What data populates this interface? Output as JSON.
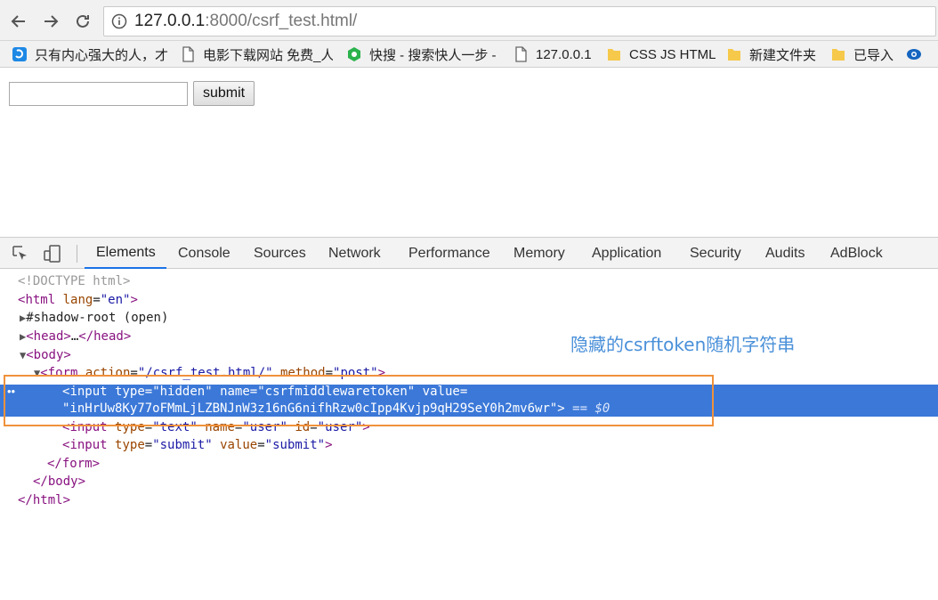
{
  "browser": {
    "url_host": "127.0.0.1",
    "url_rest": ":8000/csrf_test.html/"
  },
  "bookmarks": [
    {
      "label": "只有内心强大的人，才",
      "icon": "blue-site-icon"
    },
    {
      "label": "电影下载网站 免费_人",
      "icon": "page-icon"
    },
    {
      "label": "快搜 - 搜索快人一步 -",
      "icon": "kuaisou-icon"
    },
    {
      "label": "127.0.0.1",
      "icon": "page-icon"
    },
    {
      "label": "CSS JS HTML",
      "icon": "folder-icon"
    },
    {
      "label": "新建文件夹",
      "icon": "folder-icon"
    },
    {
      "label": "已导入",
      "icon": "folder-icon"
    }
  ],
  "page": {
    "submit_label": "submit"
  },
  "devtools": {
    "tabs": [
      "Elements",
      "Console",
      "Sources",
      "Network",
      "Performance",
      "Memory",
      "Application",
      "Security",
      "Audits",
      "AdBlock"
    ],
    "active_tab": "Elements",
    "dom": {
      "doctype": "<!DOCTYPE html>",
      "html_open": "html",
      "lang_attr": "lang",
      "lang_val": "\"en\"",
      "shadow": "#shadow-root (open)",
      "head": "head",
      "body": "body",
      "form": "form",
      "form_action_attr": "action",
      "form_action_val": "\"/csrf_test.html/\"",
      "form_method_attr": "method",
      "form_method_val": "\"post\"",
      "input": "input",
      "type_attr": "type",
      "name_attr": "name",
      "value_attr": "value",
      "id_attr": "id",
      "hidden_val": "\"hidden\"",
      "hidden_name_val": "\"csrfmiddlewaretoken\"",
      "token_val": "\"inHrUw8Ky77oFMmLjLZBNJnW3z16nG6nifhRzw0cIpp4Kvjp9qH29SeY0h2mv6wr\"",
      "dollar0": "== $0",
      "text_val": "\"text\"",
      "user_val": "\"user\"",
      "submit_val": "\"submit\""
    }
  },
  "annotation": "隐藏的csrftoken随机字符串"
}
